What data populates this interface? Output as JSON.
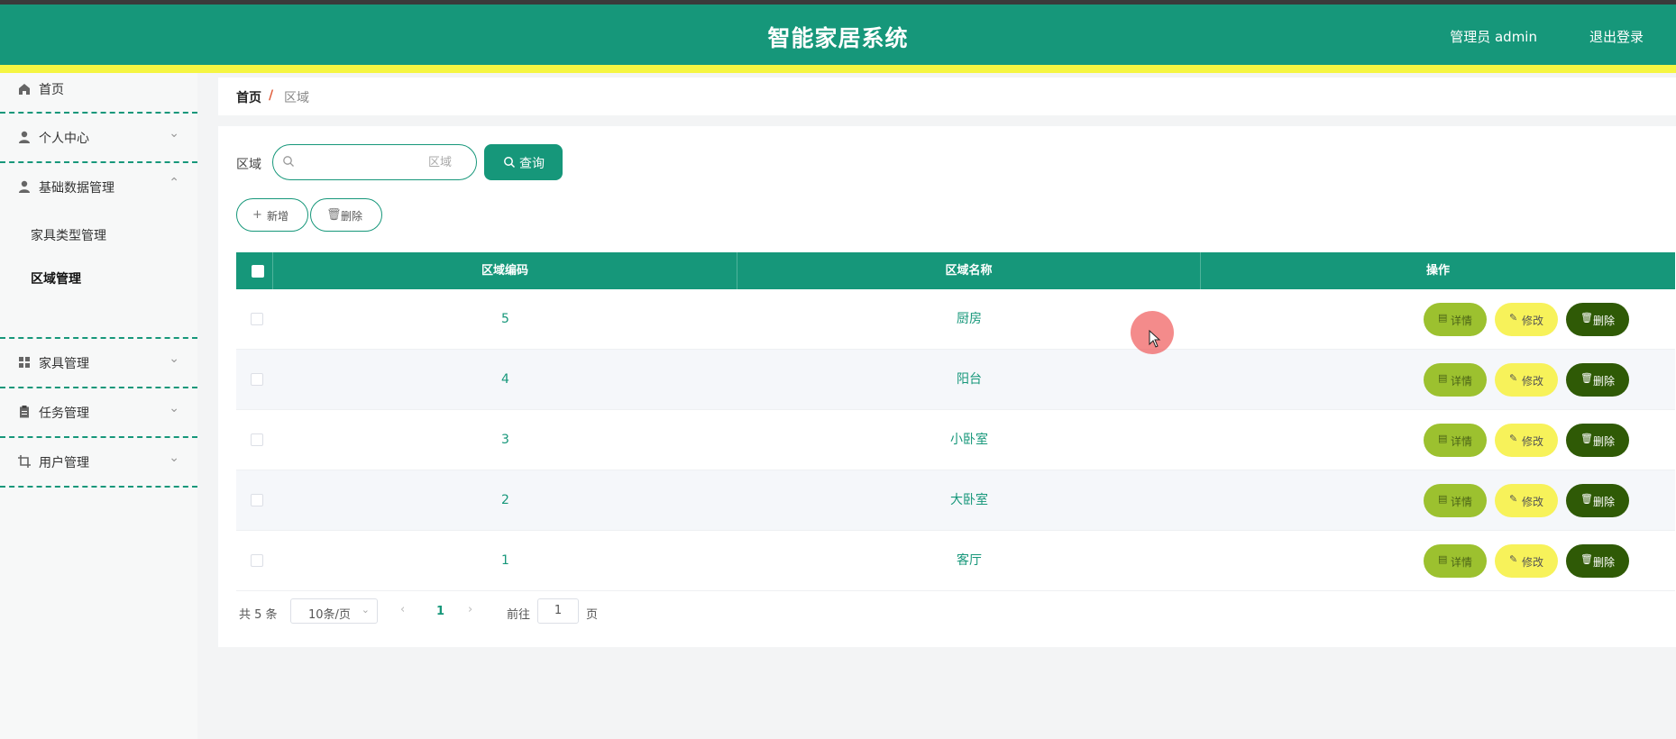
{
  "header": {
    "title": "智能家居系统",
    "user": "管理员 admin",
    "logout": "退出登录",
    "color": "#16977a",
    "accent": "#f5f542"
  },
  "sidebar": {
    "items": [
      {
        "label": "首页",
        "icon": "home-icon"
      },
      {
        "label": "个人中心",
        "icon": "person-icon"
      },
      {
        "label": "基础数据管理",
        "icon": "person-icon",
        "expanded": true,
        "children": [
          {
            "label": "家具类型管理"
          },
          {
            "label": "区域管理",
            "active": true
          }
        ]
      },
      {
        "label": "家具管理",
        "icon": "grid-icon"
      },
      {
        "label": "任务管理",
        "icon": "clipboard-icon"
      },
      {
        "label": "用户管理",
        "icon": "crop-icon"
      }
    ]
  },
  "breadcrumb": {
    "home": "首页",
    "separator": "/",
    "current": "区域"
  },
  "search": {
    "label": "区域",
    "placeholder": "区域",
    "value": "",
    "button": "查询"
  },
  "actions": {
    "add": "新增",
    "delete": "删除"
  },
  "table": {
    "headers": [
      "区域编码",
      "区域名称",
      "操作"
    ],
    "rows": [
      {
        "code": "5",
        "name": "厨房"
      },
      {
        "code": "4",
        "name": "阳台"
      },
      {
        "code": "3",
        "name": "小卧室"
      },
      {
        "code": "2",
        "name": "大卧室"
      },
      {
        "code": "1",
        "name": "客厅"
      }
    ],
    "ops": {
      "detail": "详情",
      "edit": "修改",
      "remove": "删除"
    }
  },
  "pagination": {
    "total": "共 5 条",
    "page_size": "10条/页",
    "current": "1",
    "goto_prefix": "前往",
    "goto_value": "1",
    "goto_suffix": "页"
  }
}
